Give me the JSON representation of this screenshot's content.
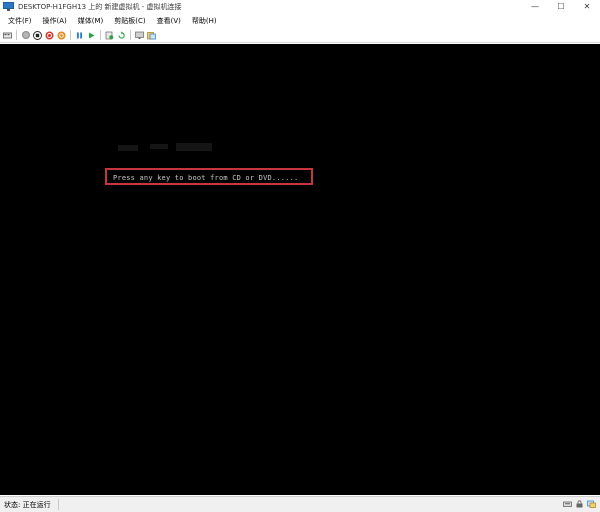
{
  "window": {
    "title": "DESKTOP-H1FGH13 上的 新建虚拟机 - 虚拟机连接",
    "minimize_symbol": "—",
    "maximize_symbol": "☐",
    "close_symbol": "✕"
  },
  "menu": {
    "items": [
      {
        "label": "文件(F)"
      },
      {
        "label": "操作(A)"
      },
      {
        "label": "媒体(M)"
      },
      {
        "label": "剪贴板(C)"
      },
      {
        "label": "查看(V)"
      },
      {
        "label": "帮助(H)"
      }
    ]
  },
  "toolbar": {
    "icons": [
      "ctrl-alt-del-icon",
      "start-icon",
      "turn-off-icon",
      "shut-down-icon",
      "save-icon",
      "pause-icon",
      "resume-icon",
      "checkpoint-icon",
      "revert-icon",
      "enhanced-session-icon",
      "share-icon"
    ]
  },
  "console": {
    "boot_message": "Press any key to boot from CD or DVD......",
    "highlight_color": "#c8353a"
  },
  "statusbar": {
    "status_text": "状态: 正在运行"
  },
  "colors": {
    "console_bg": "#000000",
    "boot_text": "#c8c8c8",
    "accent_blue": "#2b79c2"
  }
}
